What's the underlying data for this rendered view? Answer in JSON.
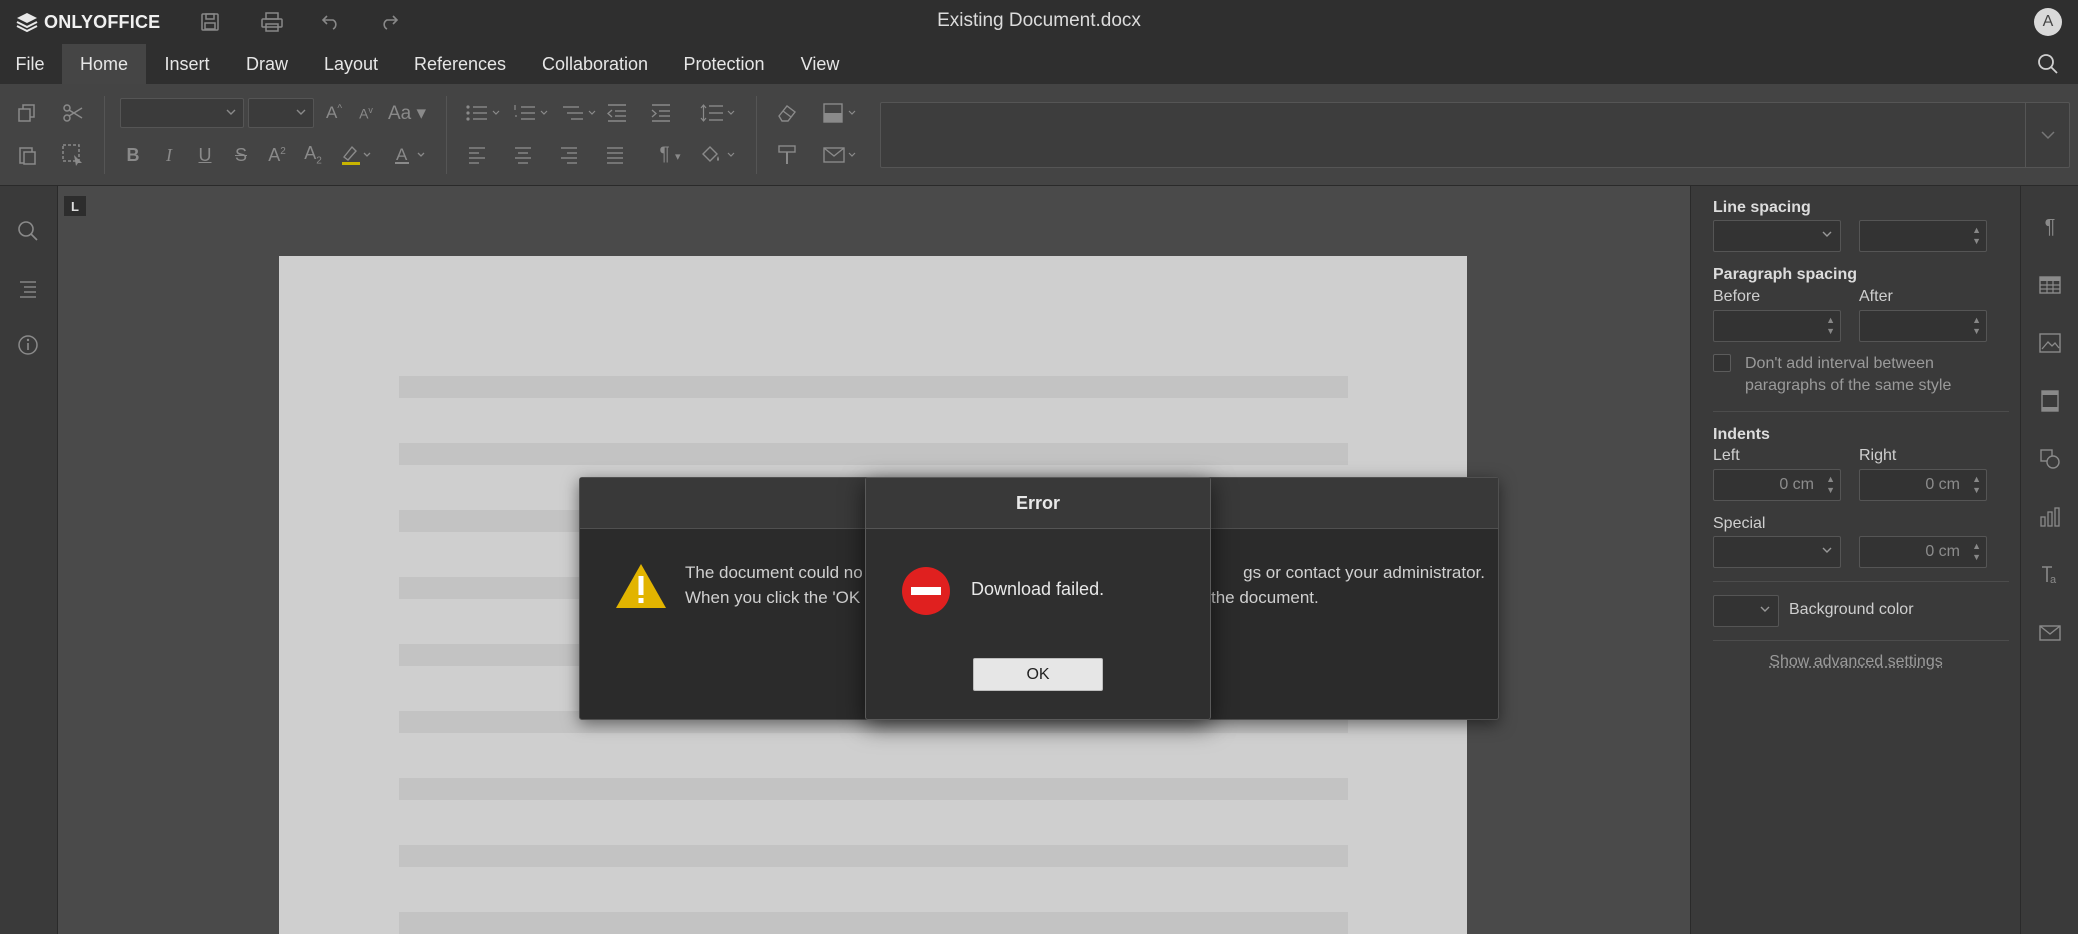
{
  "app": {
    "logo_text": "ONLYOFFICE",
    "document_title": "Existing Document.docx",
    "user_initial": "A"
  },
  "menu": {
    "tabs": [
      {
        "label": "File"
      },
      {
        "label": "Home"
      },
      {
        "label": "Insert"
      },
      {
        "label": "Draw"
      },
      {
        "label": "Layout"
      },
      {
        "label": "References"
      },
      {
        "label": "Collaboration"
      },
      {
        "label": "Protection"
      },
      {
        "label": "View"
      }
    ],
    "active_tab": "Home"
  },
  "toolbar": {
    "tab_marker": "L"
  },
  "right_panel": {
    "line_spacing": "Line spacing",
    "paragraph_spacing": "Paragraph spacing",
    "before": "Before",
    "after": "After",
    "no_interval": "Don't add interval between paragraphs of the same style",
    "indents": "Indents",
    "left": "Left",
    "right": "Right",
    "left_value": "0 cm",
    "right_value": "0 cm",
    "special": "Special",
    "special_value": "0 cm",
    "background_color": "Background color",
    "advanced": "Show advanced settings"
  },
  "dialog_behind": {
    "text_line1_start": "The document could no",
    "text_line1_end": "gs or contact your administrator.",
    "text_line2_start": "When you click the 'OK",
    "text_line2_end": "the document."
  },
  "error_dialog": {
    "title": "Error",
    "message": "Download failed.",
    "ok_label": "OK"
  },
  "colors": {
    "warning": "#e2b400",
    "error": "#e0201f",
    "accent_underline": "#c8b400"
  }
}
